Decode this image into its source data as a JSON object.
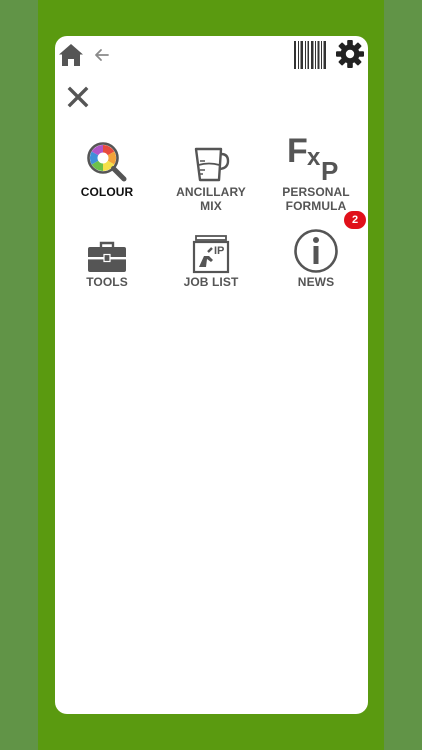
{
  "toolbar": {
    "icons": [
      "home-icon",
      "back-arrow-icon",
      "barcode-icon",
      "gear-icon"
    ]
  },
  "menu": {
    "close_icon": "close-icon",
    "tiles": [
      {
        "label": "COLOUR",
        "icon": "colour-search-icon",
        "selected": true
      },
      {
        "label": "ANCILLARY\nMIX",
        "icon": "measuring-jug-icon"
      },
      {
        "label": "PERSONAL\nFORMULA",
        "icon": "fxp-formula-icon",
        "glyph_text": {
          "f": "F",
          "x": "x",
          "p": "P"
        }
      },
      {
        "label": "TOOLS",
        "icon": "toolbox-icon"
      },
      {
        "label": "JOB LIST",
        "icon": "job-list-icon",
        "glyph_text": "IP"
      },
      {
        "label": "NEWS",
        "icon": "info-icon",
        "badge": "2"
      }
    ]
  },
  "colors": {
    "background_outer": "#619447",
    "background_inner": "#5a9a10",
    "icon": "#555555",
    "badge": "#e0101a"
  }
}
